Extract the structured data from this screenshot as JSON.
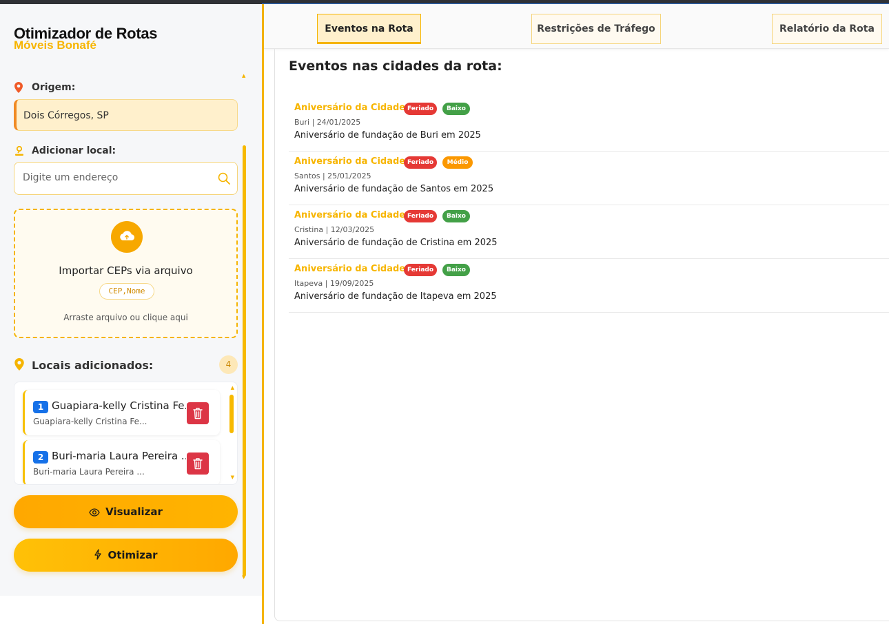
{
  "app": {
    "title": "Otimizador de Rotas",
    "subtitle": "Móveis Bonafé"
  },
  "sidebar": {
    "origin_label": "Origem:",
    "origin_value": "Dois Córregos, SP",
    "add_label": "Adicionar local:",
    "search_placeholder": "Digite um endereço",
    "import": {
      "title": "Importar CEPs via arquivo",
      "format": "CEP,Nome",
      "hint": "Arraste arquivo ou clique aqui"
    },
    "locais_label": "Locais adicionados:",
    "locais_count": "4",
    "locais": [
      {
        "num": "1",
        "title": "Guapiara-kelly Cristina Fe...",
        "sub": "Guapiara-kelly Cristina Fe..."
      },
      {
        "num": "2",
        "title": "Buri-maria Laura Pereira ...",
        "sub": "Buri-maria Laura Pereira ..."
      }
    ],
    "btn_visualizar": "Visualizar",
    "btn_otimizar": "Otimizar"
  },
  "tabs": [
    {
      "label": "Eventos na Rota",
      "active": true
    },
    {
      "label": "Restrições de Tráfego",
      "active": false
    },
    {
      "label": "Relatório da Rota",
      "active": false
    }
  ],
  "main": {
    "section_title": "Eventos nas cidades da rota:",
    "events": [
      {
        "title": "Aniversário da Cidade",
        "type": "Feriado",
        "impact": "Baixo",
        "impact_color": "#43a047",
        "meta": "Buri | 24/01/2025",
        "desc": "Aniversário de fundação de Buri em 2025"
      },
      {
        "title": "Aniversário da Cidade",
        "type": "Feriado",
        "impact": "Médio",
        "impact_color": "#fb9800",
        "meta": "Santos | 25/01/2025",
        "desc": "Aniversário de fundação de Santos em 2025"
      },
      {
        "title": "Aniversário da Cidade",
        "type": "Feriado",
        "impact": "Baixo",
        "impact_color": "#43a047",
        "meta": "Cristina | 12/03/2025",
        "desc": "Aniversário de fundação de Cristina em 2025"
      },
      {
        "title": "Aniversário da Cidade",
        "type": "Feriado",
        "impact": "Baixo",
        "impact_color": "#43a047",
        "meta": "Itapeva | 19/09/2025",
        "desc": "Aniversário de fundação de Itapeva em 2025"
      }
    ]
  },
  "colors": {
    "accent": "#f7b500",
    "origin_border": "#f08a24",
    "location_number": "#1671e8",
    "delete": "#dc3545"
  }
}
